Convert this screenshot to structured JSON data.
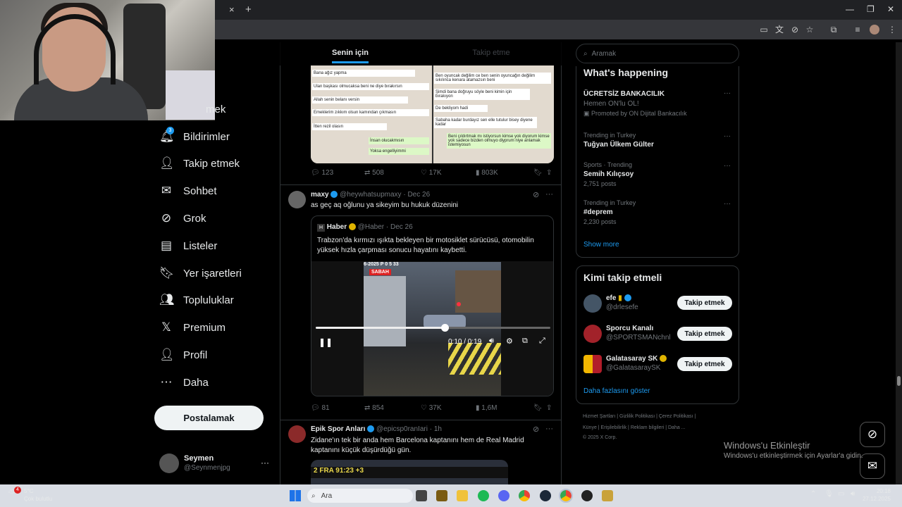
{
  "browser": {
    "tab_close": "×",
    "new_tab": "+"
  },
  "nav": {
    "partial_item": "mek",
    "items": [
      {
        "label": "Bildirimler",
        "icon": "bell-icon",
        "badge": "3"
      },
      {
        "label": "Takip etmek",
        "icon": "add-person-icon"
      },
      {
        "label": "Sohbet",
        "icon": "envelope-icon"
      },
      {
        "label": "Grok",
        "icon": "grok-icon"
      },
      {
        "label": "Listeler",
        "icon": "list-icon"
      },
      {
        "label": "Yer işaretleri",
        "icon": "bookmark-icon"
      },
      {
        "label": "Topluluklar",
        "icon": "communities-icon"
      },
      {
        "label": "Premium",
        "icon": "x-logo-icon"
      },
      {
        "label": "Profil",
        "icon": "person-icon"
      },
      {
        "label": "Daha",
        "icon": "more-circle-icon"
      }
    ],
    "post_label": "Postalamak",
    "account": {
      "name": "Seymen",
      "handle": "@Seynmenjpg",
      "more": "···"
    }
  },
  "feed": {
    "tabs": [
      "Senin için",
      "Takip etme"
    ],
    "tweet0": {
      "chat_left": [
        "Bana ağız yapma",
        "Ulan başkası olmucaksa beni ne diye bırakırsın",
        "Allah senin belanı versin",
        "Emeklerim zıkkım olsun kamından çıkmasın",
        "İtten rezil olasın",
        "İnsan olucakmısın",
        "Yoksa engelliyimmi"
      ],
      "chat_right": [
        "Ben oyuncak değilim ce ben senin oyuncağın değilim sıkılınca kenara atamazsın beni",
        "Şimdi bana doğruyu söyle beni kimin için bırakıyon",
        "De bekliyom hadi",
        "Sabaha kadar burdayız sen elle tutulur bisey diyene kadar",
        "Beni çıldırtmak mı istiyorsun kimse yok diyorum kimse yok sadece bizden olmuyo diyprum niye anlamak istemiyosun"
      ],
      "replies": "123",
      "retweets": "508",
      "likes": "17K",
      "views": "803K"
    },
    "tweet1": {
      "name": "maxy",
      "handle": "@heywhatsupmaxy",
      "date": "· Dec 26",
      "text": "as geç aq oğlunu ya sikeyim bu hukuk düzenini",
      "quote": {
        "name": "Haber",
        "handle": "@Haber",
        "date": "· Dec 26",
        "text": "Trabzon'da kırmızı ışıkta bekleyen bir motosiklet sürücüsü, otomobilin yüksek hızla çarpması sonucu hayatını kaybetti.",
        "video_overlay": "6-2025 P 0 5 33",
        "video_logo": "SABAH",
        "video_time": "0:10 / 0:19",
        "progress": 0.55
      },
      "replies": "81",
      "retweets": "854",
      "likes": "37K",
      "views": "1,6M"
    },
    "tweet2": {
      "name": "Epik Spor Anları",
      "handle": "@epicsp0ranIari",
      "date": "· 1h",
      "text": "Zidane'ın tek bir anda hem Barcelona kaptanını hem de Real Madrid kaptanını küçük düşürdüğü gün.",
      "score": "2 FRA 91:23 +3"
    }
  },
  "right": {
    "search_placeholder": "Aramak",
    "happening_title": "What's happening",
    "trends": [
      {
        "meta": "",
        "title": "ÜCRETSİZ BANKACILIK",
        "sub": "Hemen ON'lu OL!",
        "extra": "Promoted by ON Dijital Bankacılık"
      },
      {
        "meta": "Trending in Turkey",
        "title": "Tuğyan Ülkem Gülter",
        "sub": "",
        "extra": ""
      },
      {
        "meta": "Sports · Trending",
        "title": "Semih Kılıçsoy",
        "sub": "2,751 posts",
        "extra": ""
      },
      {
        "meta": "Trending in Turkey",
        "title": "#deprem",
        "sub": "2,230 posts",
        "extra": ""
      }
    ],
    "show_more": "Show more",
    "who_title": "Kimi takip etmeli",
    "who": [
      {
        "name": "efe",
        "handle": "@drlesefe",
        "btn": "Takip etmek"
      },
      {
        "name": "Sporcu Kanalı",
        "handle": "@SPORTSMANchnl",
        "btn": "Takip etmek"
      },
      {
        "name": "Galatasaray SK",
        "handle": "@GalatasaraySK",
        "btn": "Takip etmek"
      }
    ],
    "who_more": "Daha fazlasını göster",
    "footer1": "Hizmet Şartları  |  Gizlilik Politikası  |  Çerez Politikası  |",
    "footer2": "Künye  |  Erişilebilirlik  |  Reklam bilgileri  |  Daha ...",
    "footer3": "© 2025 X Corp."
  },
  "activation": {
    "line1": "Windows'u Etkinleştir",
    "line2": "Windows'u etkinleştirmek için Ayarlar'a gidin."
  },
  "taskbar": {
    "weather_temp": "5°C",
    "weather_desc": "Çok bulutlu",
    "weather_badge": "4",
    "search_placeholder": "Ara",
    "time": "20:18",
    "date": "27.12.2025"
  }
}
